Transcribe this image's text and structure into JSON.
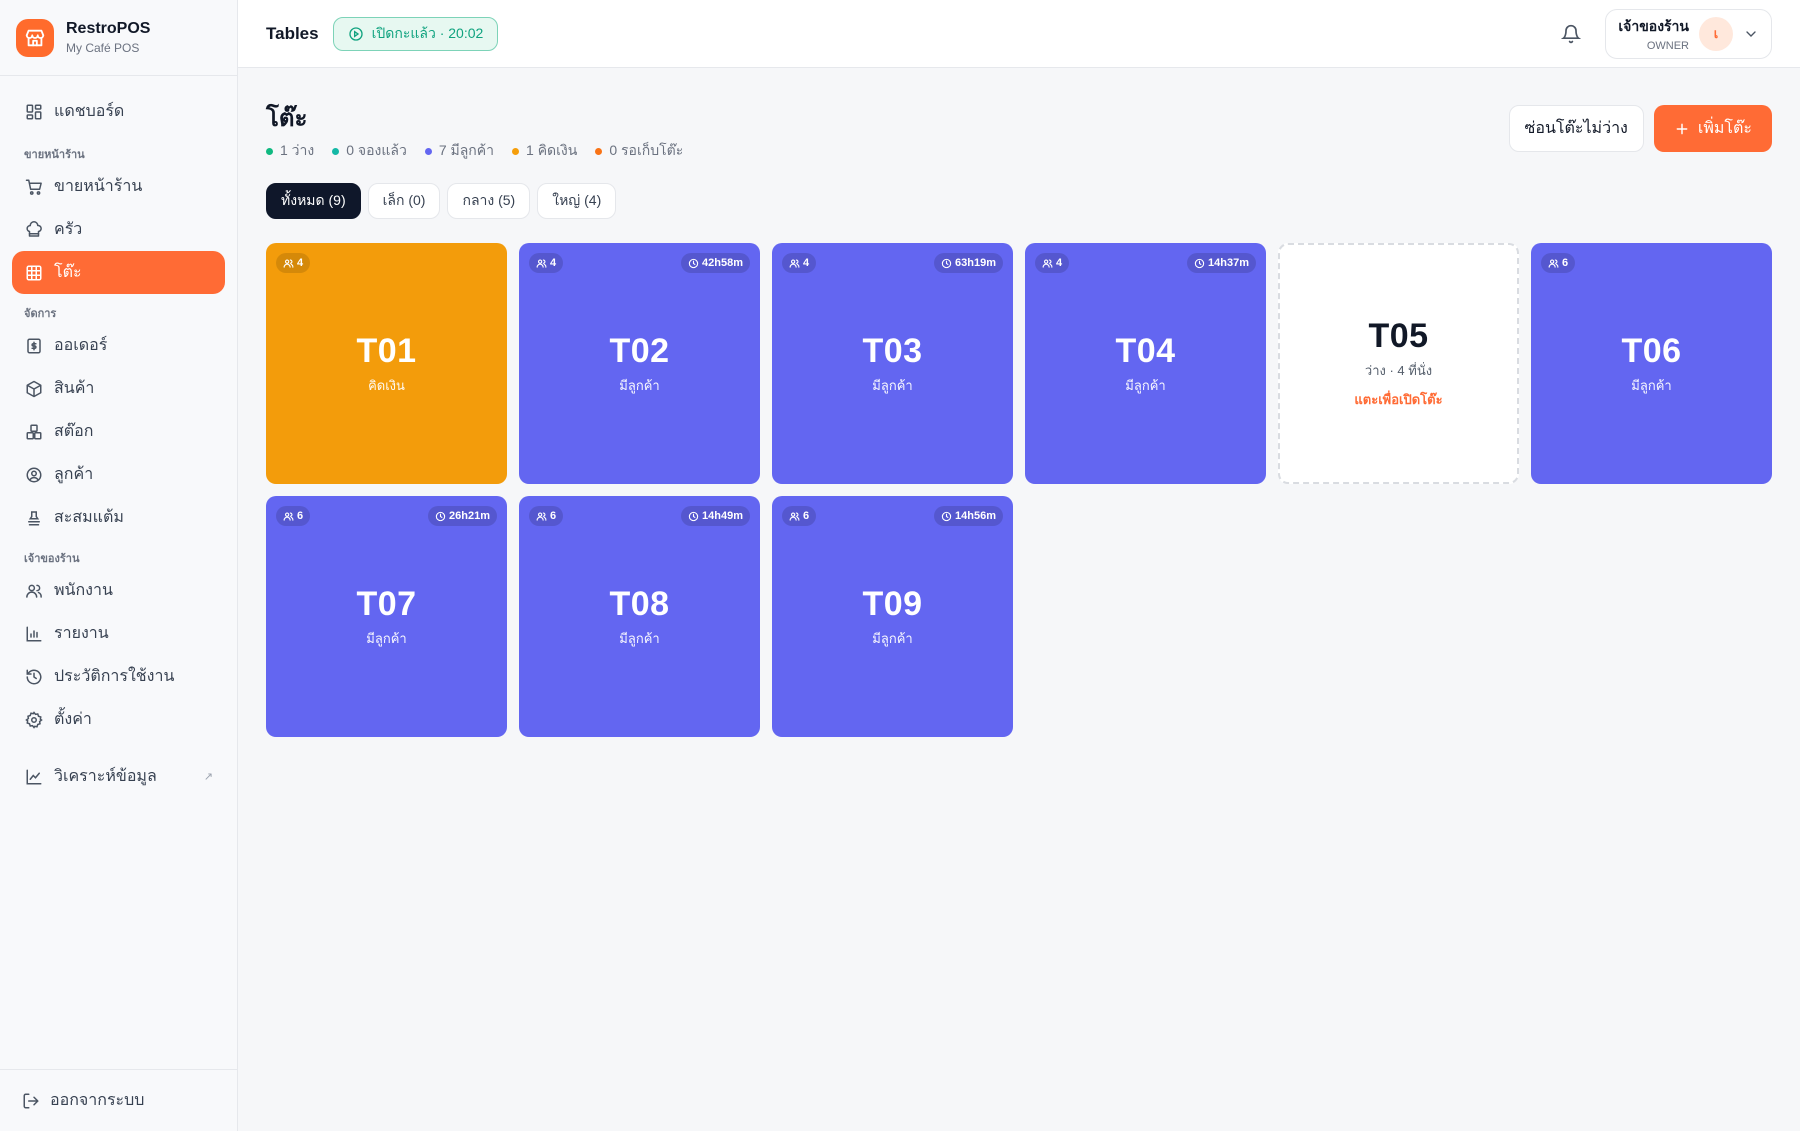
{
  "brand": {
    "name": "RestroPOS",
    "sub": "My Café POS"
  },
  "sidebar": {
    "dashboard": "แดชบอร์ด",
    "section_front": "ขายหน้าร้าน",
    "pos": "ขายหน้าร้าน",
    "kitchen": "ครัว",
    "tables": "โต๊ะ",
    "section_manage": "จัดการ",
    "orders": "ออเดอร์",
    "products": "สินค้า",
    "stock": "สต๊อก",
    "customers": "ลูกค้า",
    "loyalty": "สะสมแต้ม",
    "section_owner": "เจ้าของร้าน",
    "staff": "พนักงาน",
    "reports": "รายงาน",
    "history": "ประวัติการใช้งาน",
    "settings": "ตั้งค่า",
    "analytics": "วิเคราะห์ข้อมูล",
    "analytics_ext": "↗",
    "logout": "ออกจากระบบ"
  },
  "header": {
    "title": "Tables",
    "shift": "เปิดกะแล้ว · 20:02",
    "user_name": "เจ้าของร้าน",
    "user_role": "OWNER",
    "avatar": "เ"
  },
  "main": {
    "title": "โต๊ะ",
    "legend": [
      {
        "text": "1 ว่าง",
        "color": "#10b981"
      },
      {
        "text": "0 จองแล้ว",
        "color": "#14b8a6"
      },
      {
        "text": "7 มีลูกค้า",
        "color": "#6366f1"
      },
      {
        "text": "1 คิดเงิน",
        "color": "#f59e0b"
      },
      {
        "text": "0 รอเก็บโต๊ะ",
        "color": "#f97316"
      }
    ],
    "hide_free": "ซ่อนโต๊ะไม่ว่าง",
    "add_table": "เพิ่มโต๊ะ",
    "filters": [
      "ทั้งหมด (9)",
      "เล็ก (0)",
      "กลาง (5)",
      "ใหญ่ (4)"
    ]
  },
  "tables": [
    {
      "id": "T01",
      "seats": "4",
      "status": "คิดเงิน",
      "timer": ""
    },
    {
      "id": "T02",
      "seats": "4",
      "status": "มีลูกค้า",
      "timer": "42h58m"
    },
    {
      "id": "T03",
      "seats": "4",
      "status": "มีลูกค้า",
      "timer": "63h19m"
    },
    {
      "id": "T04",
      "seats": "4",
      "status": "มีลูกค้า",
      "timer": "14h37m"
    },
    {
      "id": "T05",
      "seats": "",
      "status": "ว่าง · 4 ที่นั่ง",
      "timer": "",
      "hint": "แตะเพื่อเปิดโต๊ะ"
    },
    {
      "id": "T06",
      "seats": "6",
      "status": "มีลูกค้า",
      "timer": ""
    },
    {
      "id": "T07",
      "seats": "6",
      "status": "มีลูกค้า",
      "timer": "26h21m"
    },
    {
      "id": "T08",
      "seats": "6",
      "status": "มีลูกค้า",
      "timer": "14h49m"
    },
    {
      "id": "T09",
      "seats": "6",
      "status": "มีลูกค้า",
      "timer": "14h56m"
    }
  ]
}
